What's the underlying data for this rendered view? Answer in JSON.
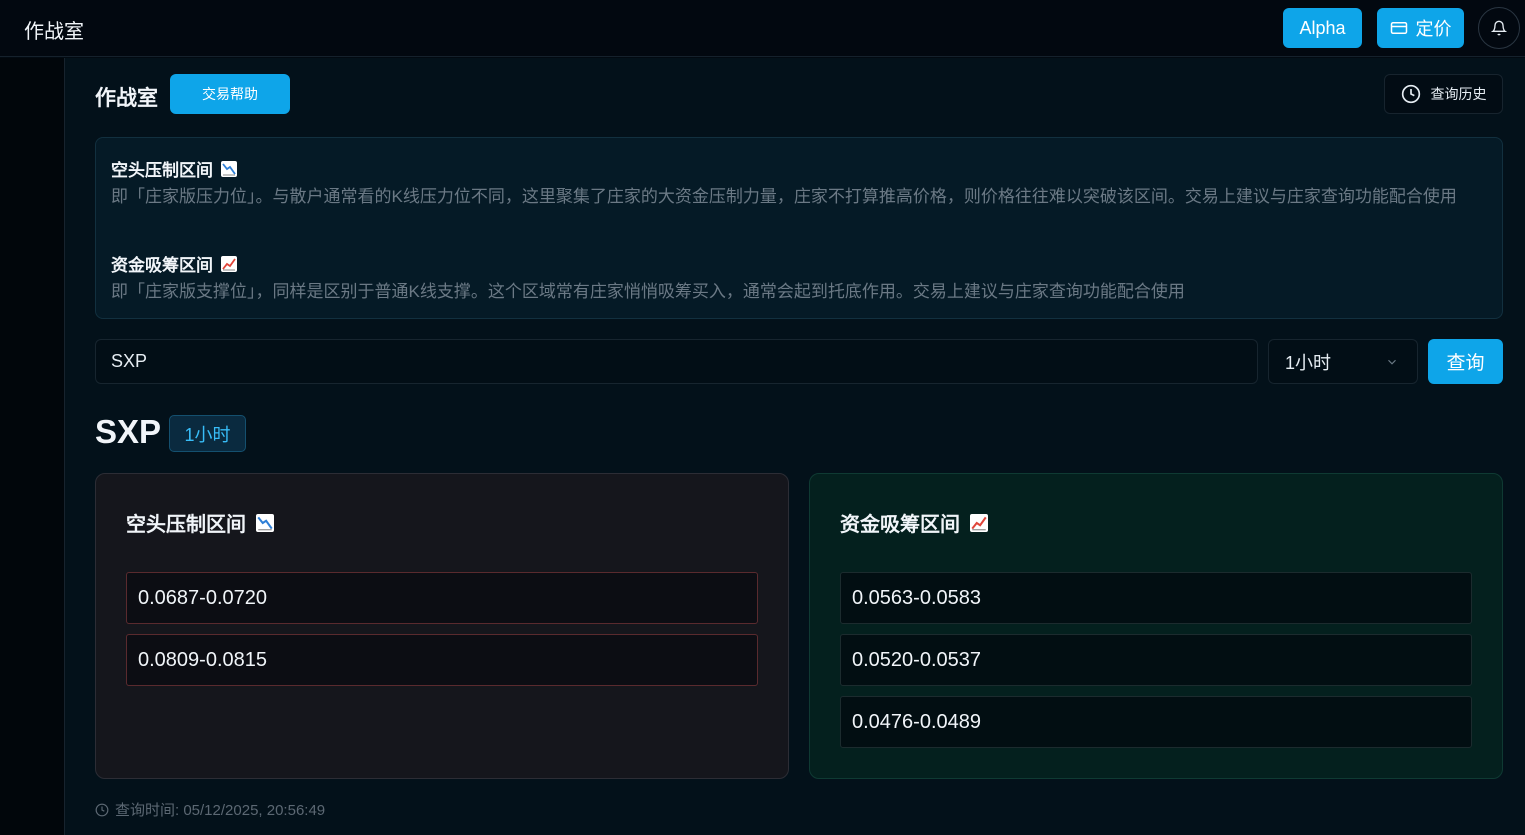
{
  "app": {
    "title": "作战室"
  },
  "topbar": {
    "alpha_label": "Alpha",
    "pricing_label": "定价"
  },
  "page": {
    "title": "作战室",
    "help_label": "交易帮助",
    "history_label": "查询历史"
  },
  "info": {
    "resistance_title": "空头压制区间",
    "resistance_desc": "即「庄家版压力位」。与散户通常看的K线压力位不同，这里聚集了庄家的大资金压制力量，庄家不打算推高价格，则价格往往难以突破该区间。交易上建议与庄家查询功能配合使用",
    "support_title": "资金吸筹区间",
    "support_desc": "即「庄家版支撑位」，同样是区别于普通K线支撑。这个区域常有庄家悄悄吸筹买入，通常会起到托底作用。交易上建议与庄家查询功能配合使用"
  },
  "search": {
    "value": "SXP",
    "timeframe": "1小时",
    "button_label": "查询"
  },
  "result": {
    "symbol": "SXP",
    "timeframe": "1小时",
    "resistance": {
      "title": "空头压制区间",
      "zones": [
        "0.0687-0.0720",
        "0.0809-0.0815"
      ]
    },
    "support": {
      "title": "资金吸筹区间",
      "zones": [
        "0.0563-0.0583",
        "0.0520-0.0537",
        "0.0476-0.0489"
      ]
    },
    "query_time": "查询时间: 05/12/2025, 20:56:49"
  },
  "icons": {
    "chart_down": "chart-decreasing-icon",
    "chart_up": "chart-increasing-icon",
    "clock": "clock-icon",
    "bell": "bell-icon",
    "card": "credit-card-icon",
    "chevron": "chevron-down-icon"
  },
  "colors": {
    "accent": "#0ea5e9",
    "bear_border": "#5a2a2e",
    "bull_bg": "#04201e"
  }
}
